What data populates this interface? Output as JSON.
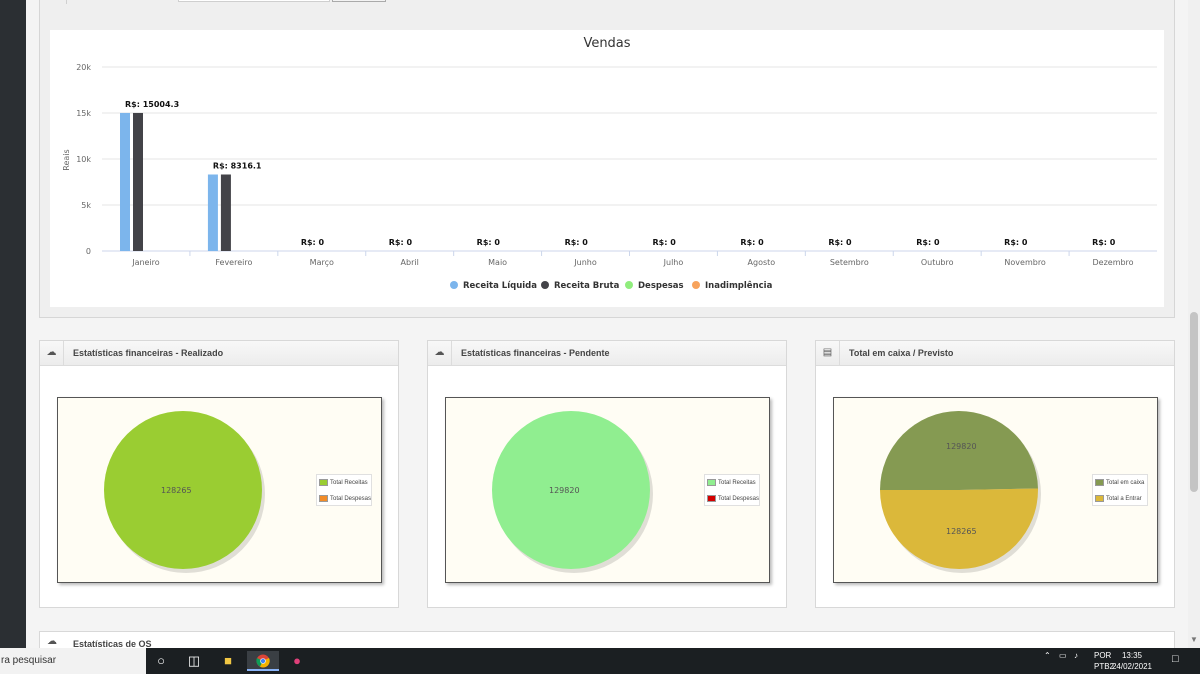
{
  "vendas_chart": {
    "chart_data": {
      "type": "bar",
      "title": "Vendas",
      "ylabel": "Reais",
      "ylim": [
        0,
        20000
      ],
      "yticks": [
        "0",
        "5k",
        "10k",
        "15k",
        "20k"
      ],
      "categories": [
        "Janeiro",
        "Fevereiro",
        "Março",
        "Abril",
        "Maio",
        "Junho",
        "Julho",
        "Agosto",
        "Setembro",
        "Outubro",
        "Novembro",
        "Dezembro"
      ],
      "data_labels": [
        "R$: 15004.3",
        "R$: 8316.1",
        "R$: 0",
        "R$: 0",
        "R$: 0",
        "R$: 0",
        "R$: 0",
        "R$: 0",
        "R$: 0",
        "R$: 0",
        "R$: 0",
        "R$: 0"
      ],
      "series": [
        {
          "name": "Receita Líquida",
          "color": "#7cb5ec",
          "values": [
            15004.3,
            8316.1,
            0,
            0,
            0,
            0,
            0,
            0,
            0,
            0,
            0,
            0
          ]
        },
        {
          "name": "Receita Bruta",
          "color": "#434348",
          "values": [
            15004.3,
            8316.1,
            0,
            0,
            0,
            0,
            0,
            0,
            0,
            0,
            0,
            0
          ]
        },
        {
          "name": "Despesas",
          "color": "#90ed7d",
          "values": [
            0,
            0,
            0,
            0,
            0,
            0,
            0,
            0,
            0,
            0,
            0,
            0
          ]
        },
        {
          "name": "Inadimplência",
          "color": "#f7a35c",
          "values": [
            0,
            0,
            0,
            0,
            0,
            0,
            0,
            0,
            0,
            0,
            0,
            0
          ]
        }
      ],
      "legend": "bottom",
      "grid": true
    }
  },
  "panels": [
    {
      "title": "Estatísticas financeiras - Realizado",
      "icon": "chart-icon",
      "chart_data": {
        "type": "pie",
        "slices": [
          {
            "label": "Total Receitas",
            "value": 128265,
            "color": "#9acd32"
          },
          {
            "label": "Total Despesas",
            "value": 0,
            "color": "#f28c28"
          }
        ],
        "value_labels": [
          "128265"
        ]
      }
    },
    {
      "title": "Estatísticas financeiras - Pendente",
      "icon": "chart-icon",
      "chart_data": {
        "type": "pie",
        "slices": [
          {
            "label": "Total Receitas",
            "value": 129820,
            "color": "#90ee90"
          },
          {
            "label": "Total Despesas",
            "value": 0,
            "color": "#d40000"
          }
        ],
        "value_labels": [
          "129820"
        ]
      }
    },
    {
      "title": "Total em caixa / Previsto",
      "icon": "cash-register-icon",
      "chart_data": {
        "type": "pie",
        "slices": [
          {
            "label": "Total em caixa",
            "value": 128265,
            "color": "#859a52"
          },
          {
            "label": "Total a Entrar",
            "value": 129820,
            "color": "#dbb83a"
          }
        ],
        "value_labels": [
          "128265",
          "129820"
        ]
      }
    }
  ],
  "bottom_panel": {
    "title": "Estatísticas de OS"
  },
  "taskbar": {
    "search_text": "ra pesquisar",
    "lang_top": "POR",
    "lang_bottom": "PTB2",
    "time": "13:35",
    "date": "24/02/2021"
  }
}
